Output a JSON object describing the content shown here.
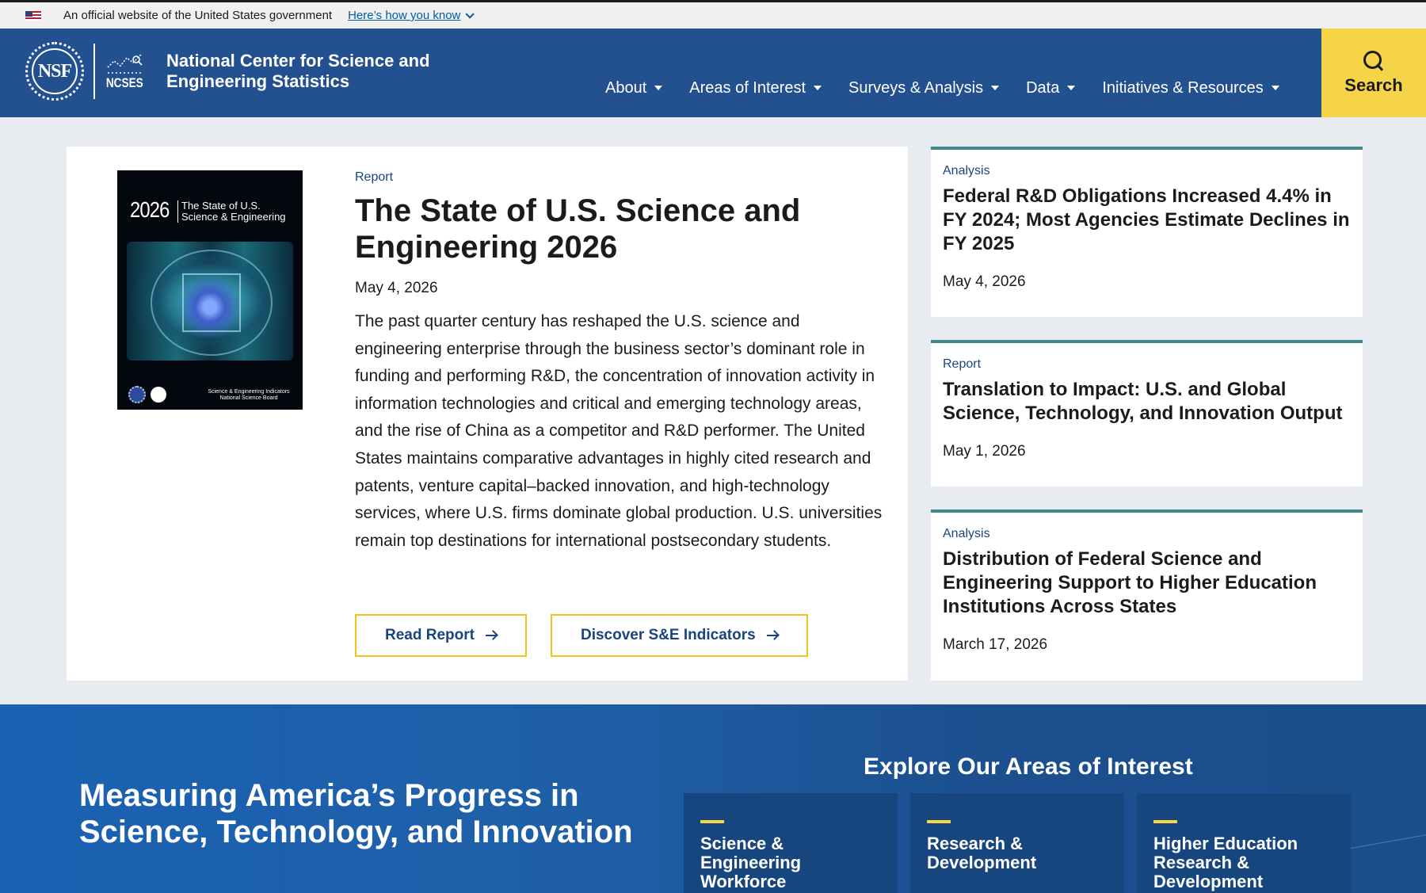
{
  "gov_banner": {
    "text": "An official website of the United States government",
    "link": "Here’s how you know"
  },
  "header": {
    "seal_text": "NSF",
    "ncses_text": "NCSES",
    "site_name_line1": "National Center for Science and",
    "site_name_line2": "Engineering Statistics",
    "nav": [
      {
        "label": "About"
      },
      {
        "label": "Areas of Interest"
      },
      {
        "label": "Surveys & Analysis"
      },
      {
        "label": "Data"
      },
      {
        "label": "Initiatives & Resources"
      }
    ],
    "search_label": "Search"
  },
  "feature": {
    "cover_year": "2026",
    "cover_title_line1": "The State of U.S.",
    "cover_title_line2": "Science & Engineering",
    "cover_pub_line1": "Science & Engineering Indicators",
    "cover_pub_line2": "National Science Board",
    "eyebrow": "Report",
    "title": "The State of U.S. Science and Engineering 2026",
    "date": "May 4, 2026",
    "description": "The past quarter century has reshaped the U.S. science and engineering enterprise through the business sector’s dominant role in funding and performing R&D, the concentration of innovation activity in information technologies and critical and emerging technology areas, and the rise of China as a competitor and R&D performer. The United States maintains comparative advantages in highly cited research and patents, venture capital–backed innovation, and high-technology services, where U.S. firms dominate global production. U.S. universities remain top destinations for international postsecondary students.",
    "buttons": [
      {
        "label": "Read Report"
      },
      {
        "label": "Discover S&E Indicators"
      }
    ]
  },
  "side_cards": [
    {
      "eyebrow": "Analysis",
      "title": "Federal R&D Obligations Increased 4.4% in FY 2024; Most Agencies Estimate Declines in FY 2025",
      "date": "May 4, 2026"
    },
    {
      "eyebrow": "Report",
      "title": "Translation to Impact: U.S. and Global Science, Technology, and Innovation Output",
      "date": "May 1, 2026"
    },
    {
      "eyebrow": "Analysis",
      "title": "Distribution of Federal Science and Engineering Support to Higher Education Institutions Across States",
      "date": "March 17, 2026"
    }
  ],
  "bottom": {
    "mission": "Measuring America’s Progress in Science, Technology, and Innovation",
    "explore_title": "Explore Our Areas of Interest",
    "areas": [
      {
        "label": "Science & Engineering Workforce"
      },
      {
        "label": "Research & Development"
      },
      {
        "label": "Higher Education Research & Development"
      }
    ]
  },
  "colors": {
    "header_bg": "#23508e",
    "search_bg": "#f5d547",
    "accent_teal": "#3e8a8f",
    "link_blue": "#1a4480",
    "button_border": "#f0c419"
  }
}
